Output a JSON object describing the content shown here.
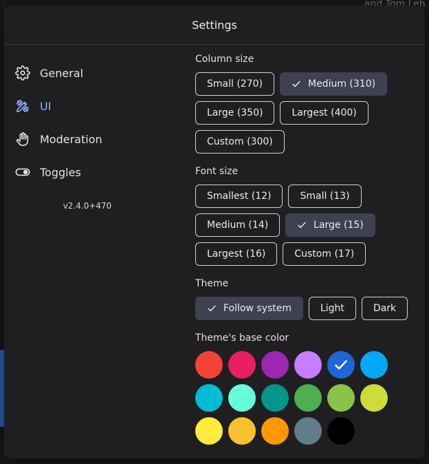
{
  "background": {
    "top_right_text": "and Tom Leh"
  },
  "modal": {
    "title": "Settings"
  },
  "nav": {
    "items": [
      {
        "label": "General",
        "icon": "gear-icon"
      },
      {
        "label": "UI",
        "icon": "brush-icon",
        "active": true
      },
      {
        "label": "Moderation",
        "icon": "hand-icon"
      },
      {
        "label": "Toggles",
        "icon": "toggle-icon"
      }
    ],
    "version": "v2.4.0+470"
  },
  "column_size": {
    "label": "Column size",
    "options": [
      {
        "label": "Small (270)"
      },
      {
        "label": "Medium (310)",
        "selected": true
      },
      {
        "label": "Large (350)"
      },
      {
        "label": "Largest (400)"
      },
      {
        "label": "Custom (300)"
      }
    ]
  },
  "font_size": {
    "label": "Font size",
    "options": [
      {
        "label": "Smallest (12)"
      },
      {
        "label": "Small (13)"
      },
      {
        "label": "Medium (14)"
      },
      {
        "label": "Large (15)",
        "selected": true
      },
      {
        "label": "Largest (16)"
      },
      {
        "label": "Custom (17)"
      }
    ]
  },
  "theme": {
    "label": "Theme",
    "options": [
      {
        "label": "Follow system",
        "selected": true
      },
      {
        "label": "Light"
      },
      {
        "label": "Dark"
      }
    ]
  },
  "base_color": {
    "label": "Theme's base color",
    "colors": [
      "#f44336",
      "#e91e63",
      "#9c27b0",
      "#c77dff",
      "#1e66d6",
      "#03a9f4",
      "#00bcd4",
      "#64ffda",
      "#009688",
      "#4caf50",
      "#8bc34a",
      "#cddc39",
      "#ffeb3b",
      "#fbc02d",
      "#ff9800",
      "#607d8b",
      "#000000"
    ],
    "selected_index": 4
  },
  "colors": {
    "accent": "#8fb2ff",
    "selected_bg": "#3d4150"
  }
}
